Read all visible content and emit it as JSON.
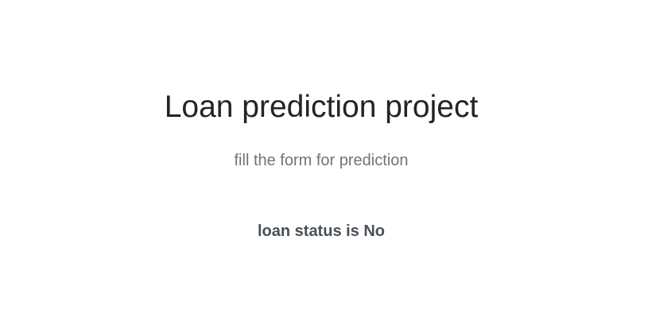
{
  "page": {
    "title": "Loan prediction project",
    "subtitle": "fill the form for prediction",
    "result_text": "loan status is No"
  },
  "colors": {
    "background": "#ffffff",
    "title": "#212529",
    "subtitle": "#6c757d",
    "result": "#495057"
  }
}
